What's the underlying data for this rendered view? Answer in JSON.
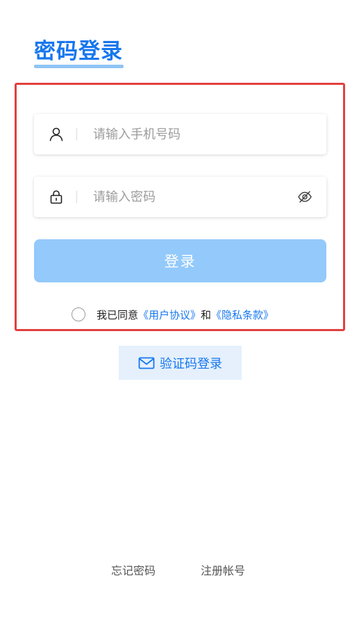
{
  "header": {
    "title": "密码登录"
  },
  "form": {
    "phone_placeholder": "请输入手机号码",
    "password_placeholder": "请输入密码",
    "user_icon": "user-icon",
    "lock_icon": "lock-icon",
    "eye_icon": "eye-off-icon",
    "login_label": "登录"
  },
  "agreement": {
    "prefix": "我已同意",
    "user_agreement": "《用户协议》",
    "and": "和",
    "privacy_policy": "《隐私条款》",
    "checked": false
  },
  "sms_login": {
    "icon": "mail-icon",
    "label": "验证码登录"
  },
  "footer": {
    "forgot_password": "忘记密码",
    "register": "注册帐号"
  },
  "colors": {
    "accent": "#1677ee",
    "button_disabled": "#93c9fb",
    "highlight_border": "#e2403e",
    "sms_bg": "#e5f0fc"
  }
}
